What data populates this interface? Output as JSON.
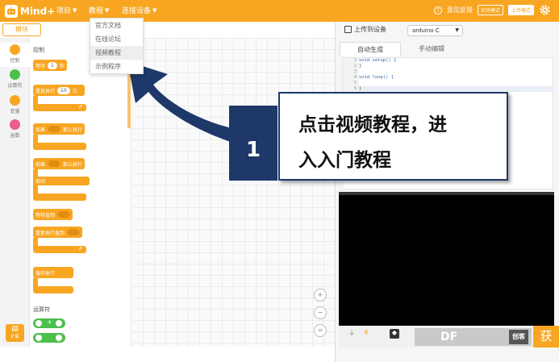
{
  "app": {
    "logo_text": "Mind+"
  },
  "menu": {
    "items": [
      {
        "label": "项目"
      },
      {
        "label": "教程"
      },
      {
        "label": "连接设备"
      }
    ]
  },
  "topright": {
    "feedback": "意见反馈",
    "realtime_mode": "实时模式",
    "upload_mode": "上传模式"
  },
  "tutorial_dropdown": {
    "items": [
      {
        "label": "官方文档"
      },
      {
        "label": "在线论坛"
      },
      {
        "label": "视频教程",
        "selected": true
      },
      {
        "label": "示例程序"
      }
    ]
  },
  "left_tab": {
    "label": "模块"
  },
  "categories": [
    {
      "label": "控制",
      "color": "#f8a622"
    },
    {
      "label": "运算符",
      "color": "#4cbf4c"
    },
    {
      "label": "变量",
      "color": "#f8a622"
    },
    {
      "label": "函数",
      "color": "#e95f8a"
    }
  ],
  "extension_button": {
    "label": "扩展"
  },
  "palette": {
    "section_control": "控制",
    "wait": {
      "label": "等待",
      "value": "1",
      "unit": "秒"
    },
    "repeat": {
      "label": "重复执行",
      "value": "10",
      "unit": "次"
    },
    "if_then": {
      "label_if": "如果",
      "label_then": "那么执行"
    },
    "if_else": {
      "label_if": "如果",
      "label_then": "那么执行",
      "label_else": "否则"
    },
    "wait_until": {
      "label": "等待直到"
    },
    "repeat_until": {
      "label": "重复执行直到"
    },
    "forever": {
      "label": "循环执行"
    },
    "section_operators": "运算符",
    "op_plus": "+"
  },
  "right_panel": {
    "upload_label": "上传到设备",
    "board_select": "arduino C",
    "tabs": [
      {
        "label": "自动生成",
        "active": true
      },
      {
        "label": "手动编辑"
      }
    ],
    "code_lines": [
      {
        "num": "1",
        "text": "void setup() {"
      },
      {
        "num": "2",
        "text": "}"
      },
      {
        "num": "3",
        "text": ""
      },
      {
        "num": "4",
        "text": "void loop() {"
      },
      {
        "num": "5",
        "text": ""
      },
      {
        "num": "6",
        "text": "}"
      }
    ]
  },
  "watermark": {
    "text": "DF",
    "box": "创客"
  },
  "corner_logo": "获",
  "callout": {
    "number": "1",
    "line1": "点击视频教程，进",
    "line2": "入入门教程",
    "color": "#1d3869"
  },
  "colors": {
    "accent": "#f8a622",
    "callout": "#1d3869"
  }
}
